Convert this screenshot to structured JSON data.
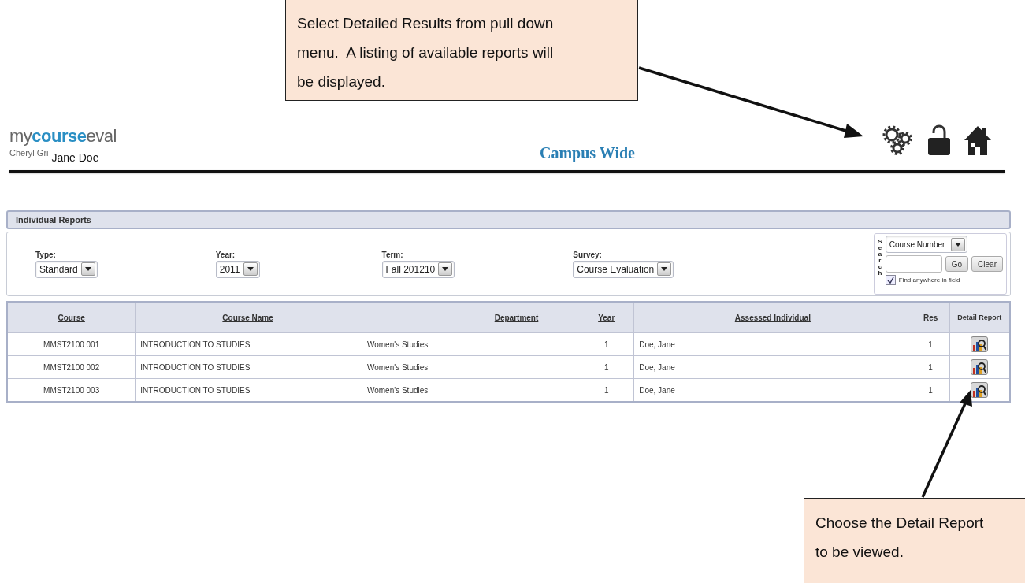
{
  "header": {
    "logo": {
      "prefix": "my",
      "highlight": "course",
      "suffix": "eval"
    },
    "user_name_cut": "Cheryl Gri",
    "user_name": "Jane Doe",
    "title": "Campus Wide"
  },
  "panel": {
    "title": "Individual Reports",
    "filters": [
      {
        "label": "Type:",
        "value": "Standard"
      },
      {
        "label": "Year:",
        "value": "2011"
      },
      {
        "label": "Term:",
        "value": "Fall 201210"
      },
      {
        "label": "Survey:",
        "value": "Course Evaluation"
      }
    ],
    "search": {
      "label": "Search",
      "field": "Course Number",
      "go": "Go",
      "clear": "Clear",
      "option_label": "Find anywhere in field",
      "checked": true
    }
  },
  "table": {
    "columns": [
      {
        "label": "Course",
        "sortable": true
      },
      {
        "label": "Course Name",
        "sortable": true
      },
      {
        "label": "Department",
        "sortable": true
      },
      {
        "label": "Year",
        "sortable": true
      },
      {
        "label": "Assessed Individual",
        "sortable": true
      },
      {
        "label": "Res",
        "sortable": false
      },
      {
        "label": "Detail Report",
        "sortable": false
      }
    ],
    "rows": [
      {
        "cells": [
          "MMST2100 001",
          "INTRODUCTION TO STUDIES",
          "Women's Studies",
          "1",
          "Doe, Jane",
          "1"
        ]
      },
      {
        "cells": [
          "MMST2100 002",
          "INTRODUCTION TO STUDIES",
          "Women's Studies",
          "1",
          "Doe, Jane",
          "1"
        ]
      },
      {
        "cells": [
          "MMST2100 003",
          "INTRODUCTION TO STUDIES",
          "Women's Studies",
          "1",
          "Doe, Jane",
          "1"
        ]
      }
    ]
  },
  "annotations": [
    {
      "text": "Select Detailed Results from pull down menu.  A listing of available reports will be displayed."
    },
    {
      "text": "Choose the Detail Report to be viewed."
    }
  ]
}
